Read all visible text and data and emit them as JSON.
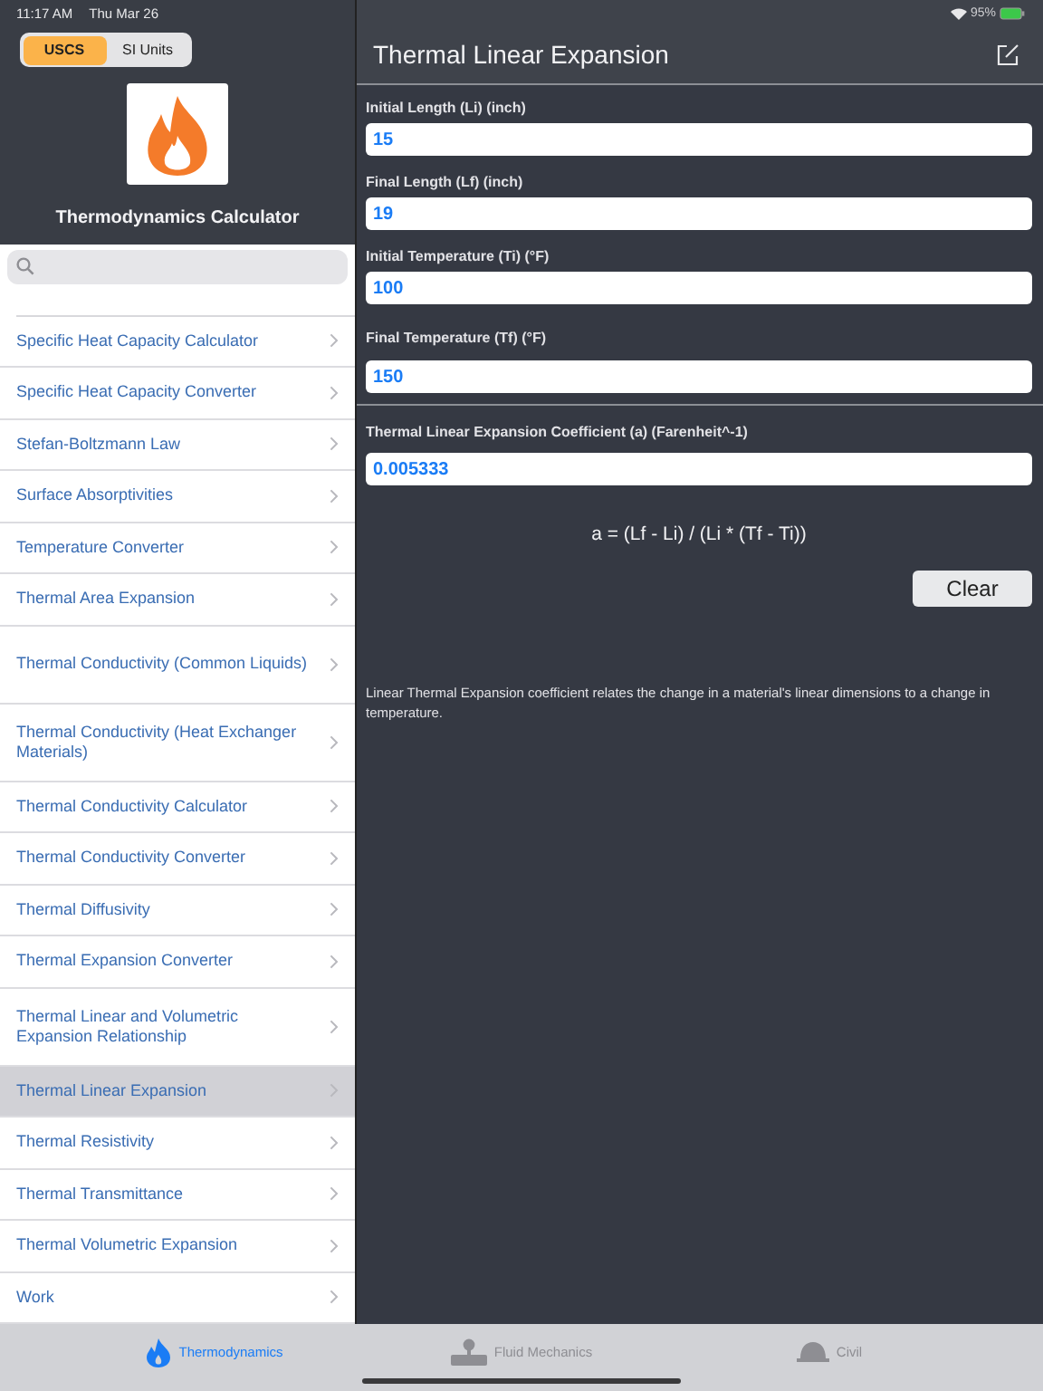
{
  "status_bar": {
    "time": "11:17 AM",
    "date": "Thu Mar 26",
    "battery": "95%"
  },
  "unit_segments": [
    {
      "label": "USCS",
      "selected": true
    },
    {
      "label": "SI Units",
      "selected": false
    }
  ],
  "app_title": "Thermodynamics Calculator",
  "sidebar": {
    "items": [
      {
        "label": "Specific Heat Capacity Calculator",
        "selected": false
      },
      {
        "label": "Specific Heat Capacity Converter",
        "selected": false
      },
      {
        "label": "Stefan-Boltzmann Law",
        "selected": false
      },
      {
        "label": "Surface Absorptivities",
        "selected": false
      },
      {
        "label": "Temperature Converter",
        "selected": false
      },
      {
        "label": "Thermal Area Expansion",
        "selected": false
      },
      {
        "label": "Thermal Conductivity (Common Liquids)",
        "selected": false
      },
      {
        "label": "Thermal Conductivity (Heat Exchanger Materials)",
        "selected": false
      },
      {
        "label": "Thermal Conductivity Calculator",
        "selected": false
      },
      {
        "label": "Thermal Conductivity Converter",
        "selected": false
      },
      {
        "label": "Thermal Diffusivity",
        "selected": false
      },
      {
        "label": "Thermal Expansion Converter",
        "selected": false
      },
      {
        "label": "Thermal Linear and Volumetric Expansion Relationship",
        "selected": false
      },
      {
        "label": "Thermal Linear Expansion",
        "selected": true
      },
      {
        "label": "Thermal Resistivity",
        "selected": false
      },
      {
        "label": "Thermal Transmittance",
        "selected": false
      },
      {
        "label": "Thermal Volumetric Expansion",
        "selected": false
      },
      {
        "label": "Work",
        "selected": false
      }
    ]
  },
  "detail": {
    "title": "Thermal Linear Expansion",
    "inputs": [
      {
        "label": "Initial Length (Li) (inch)",
        "value": "15"
      },
      {
        "label": "Final Length (Lf) (inch)",
        "value": "19"
      },
      {
        "label": "Initial Temperature (Ti) (°F)",
        "value": "100"
      },
      {
        "label": "Final Temperature (Tf) (°F)",
        "value": "150"
      }
    ],
    "result": {
      "label": "Thermal Linear Expansion Coefficient (a) (Farenheit^-1)",
      "value": "0.005333"
    },
    "formula": "a = (Lf - Li) / (Li * (Tf - Ti))",
    "clear_button": "Clear",
    "description": "Linear Thermal Expansion coefficient relates the change in a material's linear dimensions to a change in temperature."
  },
  "tab_bar": [
    {
      "kind": "flame",
      "label": "Thermodynamics",
      "selected": true
    },
    {
      "kind": "pipe",
      "label": "Fluid Mechanics",
      "selected": false
    },
    {
      "kind": "helmet",
      "label": "Civil",
      "selected": false
    }
  ]
}
